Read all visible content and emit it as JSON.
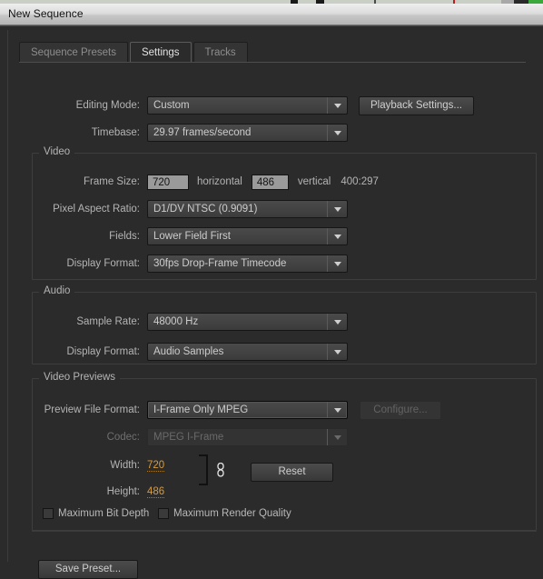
{
  "window": {
    "title": "New Sequence"
  },
  "tabs": [
    {
      "label": "Sequence Presets",
      "active": false
    },
    {
      "label": "Settings",
      "active": true
    },
    {
      "label": "Tracks",
      "active": false
    }
  ],
  "settings": {
    "editing_mode": {
      "label": "Editing Mode:",
      "value": "Custom"
    },
    "playback_settings_button": "Playback Settings...",
    "timebase": {
      "label": "Timebase:",
      "value": "29.97 frames/second"
    }
  },
  "video_group": {
    "title": "Video",
    "frame_size": {
      "label": "Frame Size:",
      "horizontal_value": "720",
      "horizontal_label": "horizontal",
      "vertical_value": "486",
      "vertical_label": "vertical",
      "ratio": "400:297"
    },
    "pixel_aspect_ratio": {
      "label": "Pixel Aspect Ratio:",
      "value": "D1/DV NTSC (0.9091)"
    },
    "fields": {
      "label": "Fields:",
      "value": "Lower Field First"
    },
    "display_format": {
      "label": "Display Format:",
      "value": "30fps Drop-Frame Timecode"
    }
  },
  "audio_group": {
    "title": "Audio",
    "sample_rate": {
      "label": "Sample Rate:",
      "value": "48000 Hz"
    },
    "display_format": {
      "label": "Display Format:",
      "value": "Audio Samples"
    }
  },
  "video_previews_group": {
    "title": "Video Previews",
    "preview_file_format": {
      "label": "Preview File Format:",
      "value": "I-Frame Only MPEG"
    },
    "configure_button": "Configure...",
    "codec": {
      "label": "Codec:",
      "value": "MPEG I-Frame"
    },
    "width": {
      "label": "Width:",
      "value": "720"
    },
    "height": {
      "label": "Height:",
      "value": "486"
    },
    "reset_button": "Reset",
    "link_icon": "chain-link-icon",
    "max_bit_depth": {
      "label": "Maximum Bit Depth",
      "checked": false
    },
    "max_render_quality": {
      "label": "Maximum Render Quality",
      "checked": false
    }
  },
  "footer": {
    "save_preset_button": "Save Preset..."
  },
  "colors": {
    "dialog_bg": "#2b2b2b",
    "titlebar": "#dcdcdc",
    "accent_orange": "#d79b3b",
    "label_text": "#b4b4b4",
    "field_bg": "#9a9a9a"
  }
}
